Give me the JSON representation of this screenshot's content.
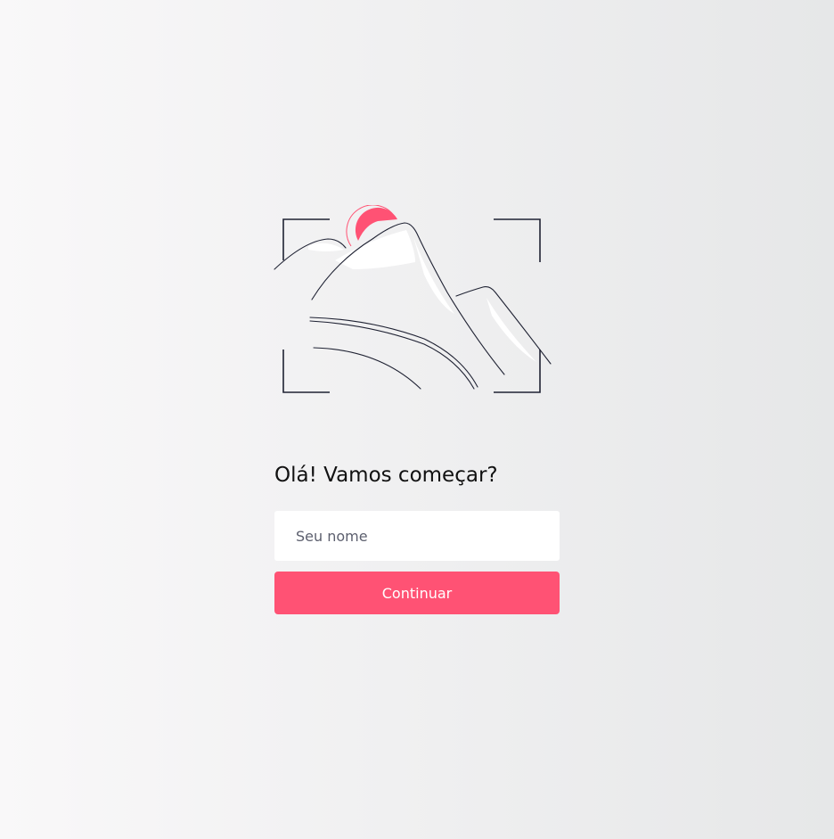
{
  "welcome": {
    "title": "Olá! Vamos começar?",
    "name_placeholder": "Seu nome",
    "name_value": "",
    "continue_label": "Continuar"
  },
  "illustration": {
    "icon": "mountain-landscape-icon",
    "sun_color": "#ff5274",
    "line_color": "#1f2233"
  },
  "colors": {
    "accent": "#ff5274",
    "background_light": "#f9f8f9",
    "background_dark": "#e6e7e8"
  }
}
